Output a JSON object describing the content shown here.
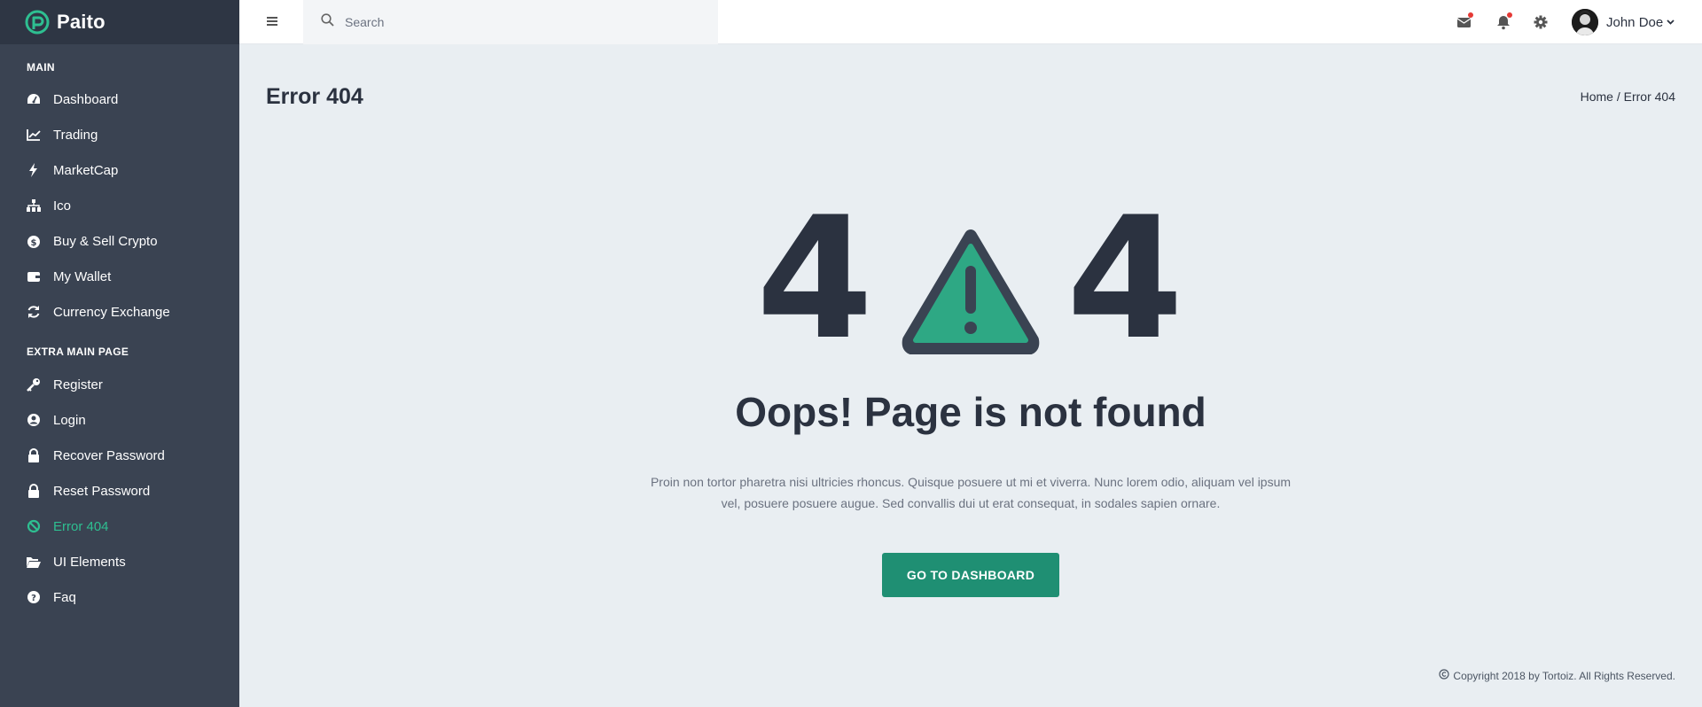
{
  "brand": {
    "name": "Paito"
  },
  "sidebar": {
    "sections": [
      {
        "title": "Main"
      },
      {
        "title": "Extra Main Page"
      }
    ],
    "main_items": [
      {
        "label": "Dashboard",
        "icon": "dashboard-icon"
      },
      {
        "label": "Trading",
        "icon": "line-chart-icon"
      },
      {
        "label": "MarketCap",
        "icon": "bolt-icon"
      },
      {
        "label": "Ico",
        "icon": "sitemap-icon"
      },
      {
        "label": "Buy & Sell Crypto",
        "icon": "money-bag-icon"
      },
      {
        "label": "My Wallet",
        "icon": "wallet-icon"
      },
      {
        "label": "Currency Exchange",
        "icon": "refresh-icon"
      }
    ],
    "extra_items": [
      {
        "label": "Register",
        "icon": "key-icon"
      },
      {
        "label": "Login",
        "icon": "user-circle-icon"
      },
      {
        "label": "Recover Password",
        "icon": "lock-icon"
      },
      {
        "label": "Reset Password",
        "icon": "lock-icon"
      },
      {
        "label": "Error 404",
        "icon": "ban-icon",
        "active": true
      },
      {
        "label": "UI Elements",
        "icon": "folder-open-icon"
      },
      {
        "label": "Faq",
        "icon": "question-circle-icon"
      }
    ]
  },
  "topbar": {
    "search_placeholder": "Search",
    "user_name": "John Doe",
    "icons": [
      "mail-icon",
      "bell-icon",
      "gear-icon"
    ]
  },
  "page": {
    "title": "Error 404",
    "breadcrumb": "Home / Error 404"
  },
  "error": {
    "digit_left": "4",
    "digit_right": "4",
    "heading": "Oops! Page is not found",
    "description_line1": "Proin non tortor pharetra nisi ultricies rhoncus. Quisque posuere ut mi et viverra. Nunc lorem odio, aliquam vel ipsum",
    "description_line2": "vel, posuere posuere augue. Sed convallis dui ut erat consequat, in sodales sapien ornare.",
    "button_label": "GO TO DASHBOARD"
  },
  "footer": {
    "copyright": "Copyright 2018 by Tortoiz. All Rights Reserved."
  },
  "colors": {
    "sidebar_bg": "#3a4352",
    "brand_bg": "#2e3644",
    "accent": "#2ebf91",
    "button": "#1f8f73",
    "content_bg": "#e9eef2",
    "text_dark": "#2b3240"
  }
}
